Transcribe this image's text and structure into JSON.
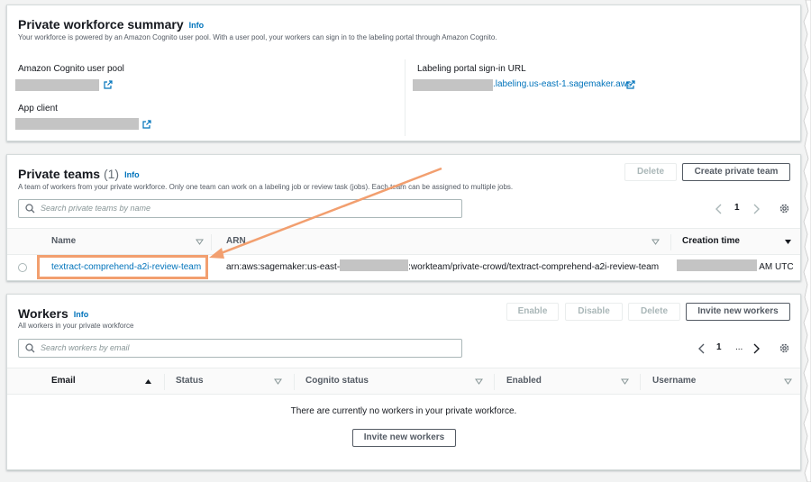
{
  "summary": {
    "title": "Private workforce summary",
    "info": "Info",
    "description": "Your workforce is powered by an Amazon Cognito user pool. With a user pool, your workers can sign in to the labeling portal through Amazon Cognito.",
    "user_pool_label": "Amazon Cognito user pool",
    "app_client_label": "App client",
    "portal_label": "Labeling portal sign-in URL",
    "portal_url_suffix": ".labeling.us-east-1.sagemaker.aws"
  },
  "teams": {
    "title": "Private teams",
    "count": "(1)",
    "info": "Info",
    "description": "A team of workers from your private workforce. Only one team can work on a labeling job or review task (jobs). Each team can be assigned to multiple jobs.",
    "delete_label": "Delete",
    "create_label": "Create private team",
    "search_placeholder": "Search private teams by name",
    "page": "1",
    "columns": [
      "Name",
      "ARN",
      "Creation time"
    ],
    "rows": [
      {
        "name": "textract-comprehend-a2i-review-team",
        "arn_prefix": "arn:aws:sagemaker:us-east-",
        "arn_suffix": ":workteam/private-crowd/textract-comprehend-a2i-review-team",
        "time_suffix": "AM UTC"
      }
    ]
  },
  "workers": {
    "title": "Workers",
    "info": "Info",
    "description": "All workers in your private workforce",
    "enable_label": "Enable",
    "disable_label": "Disable",
    "delete_label": "Delete",
    "invite_label": "Invite new workers",
    "search_placeholder": "Search workers by email",
    "page": "1",
    "ellipsis": "...",
    "columns": [
      "Email",
      "Status",
      "Cognito status",
      "Enabled",
      "Username"
    ],
    "empty_text": "There are currently no workers in your private workforce.",
    "empty_invite_label": "Invite new workers"
  },
  "colors": {
    "link": "#0073bb",
    "highlight": "#f29f6f",
    "redaction": "#c4c4c4"
  }
}
